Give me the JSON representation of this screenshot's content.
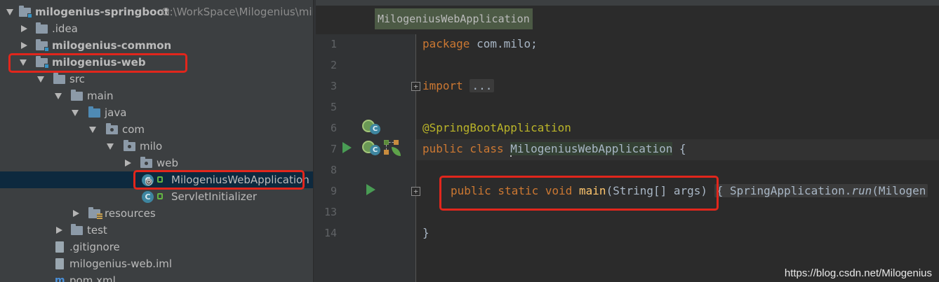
{
  "project_tree": {
    "root": {
      "name": "milogenius-springboot",
      "path": "G:\\WorkSpace\\Milogenius\\mil"
    },
    "items": [
      {
        "label": ".idea"
      },
      {
        "label": "milogenius-common"
      },
      {
        "label": "milogenius-web"
      },
      {
        "label": "src"
      },
      {
        "label": "main"
      },
      {
        "label": "java"
      },
      {
        "label": "com"
      },
      {
        "label": "milo"
      },
      {
        "label": "web"
      },
      {
        "label": "MilogeniusWebApplication"
      },
      {
        "label": "ServletInitializer"
      },
      {
        "label": "resources"
      },
      {
        "label": "test"
      },
      {
        "label": ".gitignore"
      },
      {
        "label": "milogenius-web.iml"
      },
      {
        "label": "pom.xml"
      }
    ],
    "class_icon_letter": "C"
  },
  "editor": {
    "breadcrumb": "MilogeniusWebApplication",
    "fold_marker": "+",
    "bean_icon_letter": "C",
    "line_numbers": [
      "1",
      "2",
      "3",
      "5",
      "6",
      "7",
      "8",
      "9",
      "13",
      "14"
    ],
    "code": {
      "l1_kw": "package",
      "l1_rest": " com.milo;",
      "l3_kw": "import",
      "l3_collapsed": "...",
      "l6_annotation": "@SpringBootApplication",
      "l7_kw": "public class",
      "l7_name": "MilogeniusWebApplication",
      "l7_rest": " {",
      "l9_kw": "public static void",
      "l9_fn": "main",
      "l9_args": "(String[] args)",
      "l9_collapsed_open": "{",
      "l9_collapsed_body": " SpringApplication.",
      "l9_collapsed_method": "run",
      "l9_collapsed_tail": "(Milogen",
      "l13": "}"
    }
  },
  "watermark": "https://blog.csdn.net/Milogenius",
  "colors": {
    "highlight_box": "#e1261c",
    "keyword": "#cc7832",
    "annotation": "#bbb529",
    "method": "#ffc66d"
  }
}
